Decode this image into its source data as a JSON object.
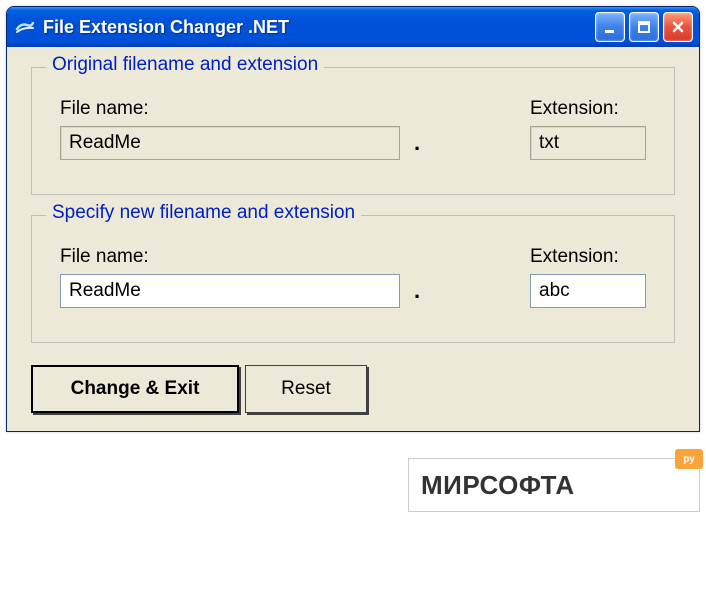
{
  "window": {
    "title": "File Extension Changer .NET"
  },
  "group1": {
    "legend": "Original filename and extension",
    "filename_label": "File name:",
    "filename_value": "ReadMe",
    "extension_label": "Extension:",
    "extension_value": "txt",
    "dot": "."
  },
  "group2": {
    "legend": "Specify new filename and extension",
    "filename_label": "File name:",
    "filename_value": "ReadMe",
    "extension_label": "Extension:",
    "extension_value": "abc",
    "dot": "."
  },
  "buttons": {
    "change_exit": "Change & Exit",
    "reset": "Reset"
  },
  "watermark": {
    "text": "МИРСОФТА",
    "badge": "ру"
  }
}
